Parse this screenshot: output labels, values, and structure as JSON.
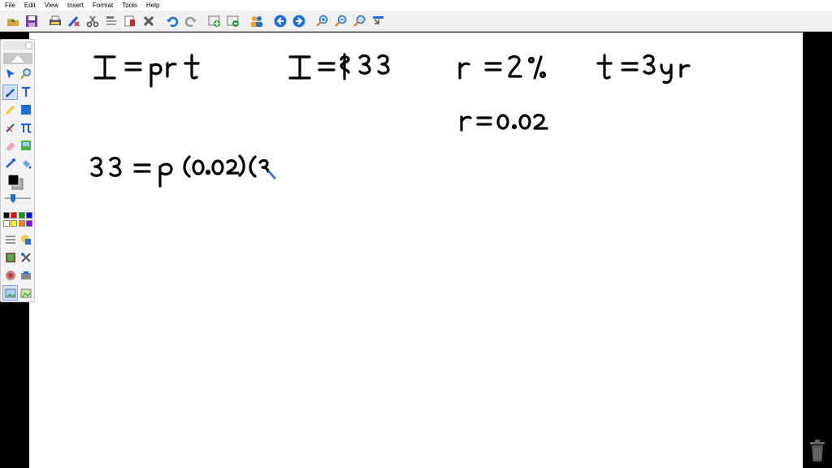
{
  "menu": {
    "items": [
      "File",
      "Edit",
      "View",
      "Insert",
      "Format",
      "Tools",
      "Help"
    ]
  },
  "toolbar": {
    "buttons": [
      "open-icon",
      "save-icon",
      "print-icon",
      "clear-icon",
      "cut-icon",
      "copy-icon",
      "paste-icon",
      "delete-icon",
      "undo-icon",
      "redo-icon",
      "new-page-icon",
      "duplicate-page-icon",
      "share-icon",
      "previous-page-icon",
      "next-page-icon",
      "zoom-in-icon",
      "zoom-out-icon",
      "zoom-fit-icon",
      "screen-capture-icon"
    ]
  },
  "canvas": {
    "handwriting": {
      "line1_formula": "I = prt",
      "line1_interest": "I = $33",
      "line1_rate": "r = 2%",
      "line1_time": "t = 3 yr",
      "line2_rate_decimal": "r = 0.02",
      "line3_equation": "33 = p (0.02)(3"
    }
  },
  "palette": {
    "colors": [
      "#000000",
      "#ff0000",
      "#00a000",
      "#0000ff",
      "#ffffff",
      "#ffff00",
      "#ff8000",
      "#8000ff"
    ]
  }
}
